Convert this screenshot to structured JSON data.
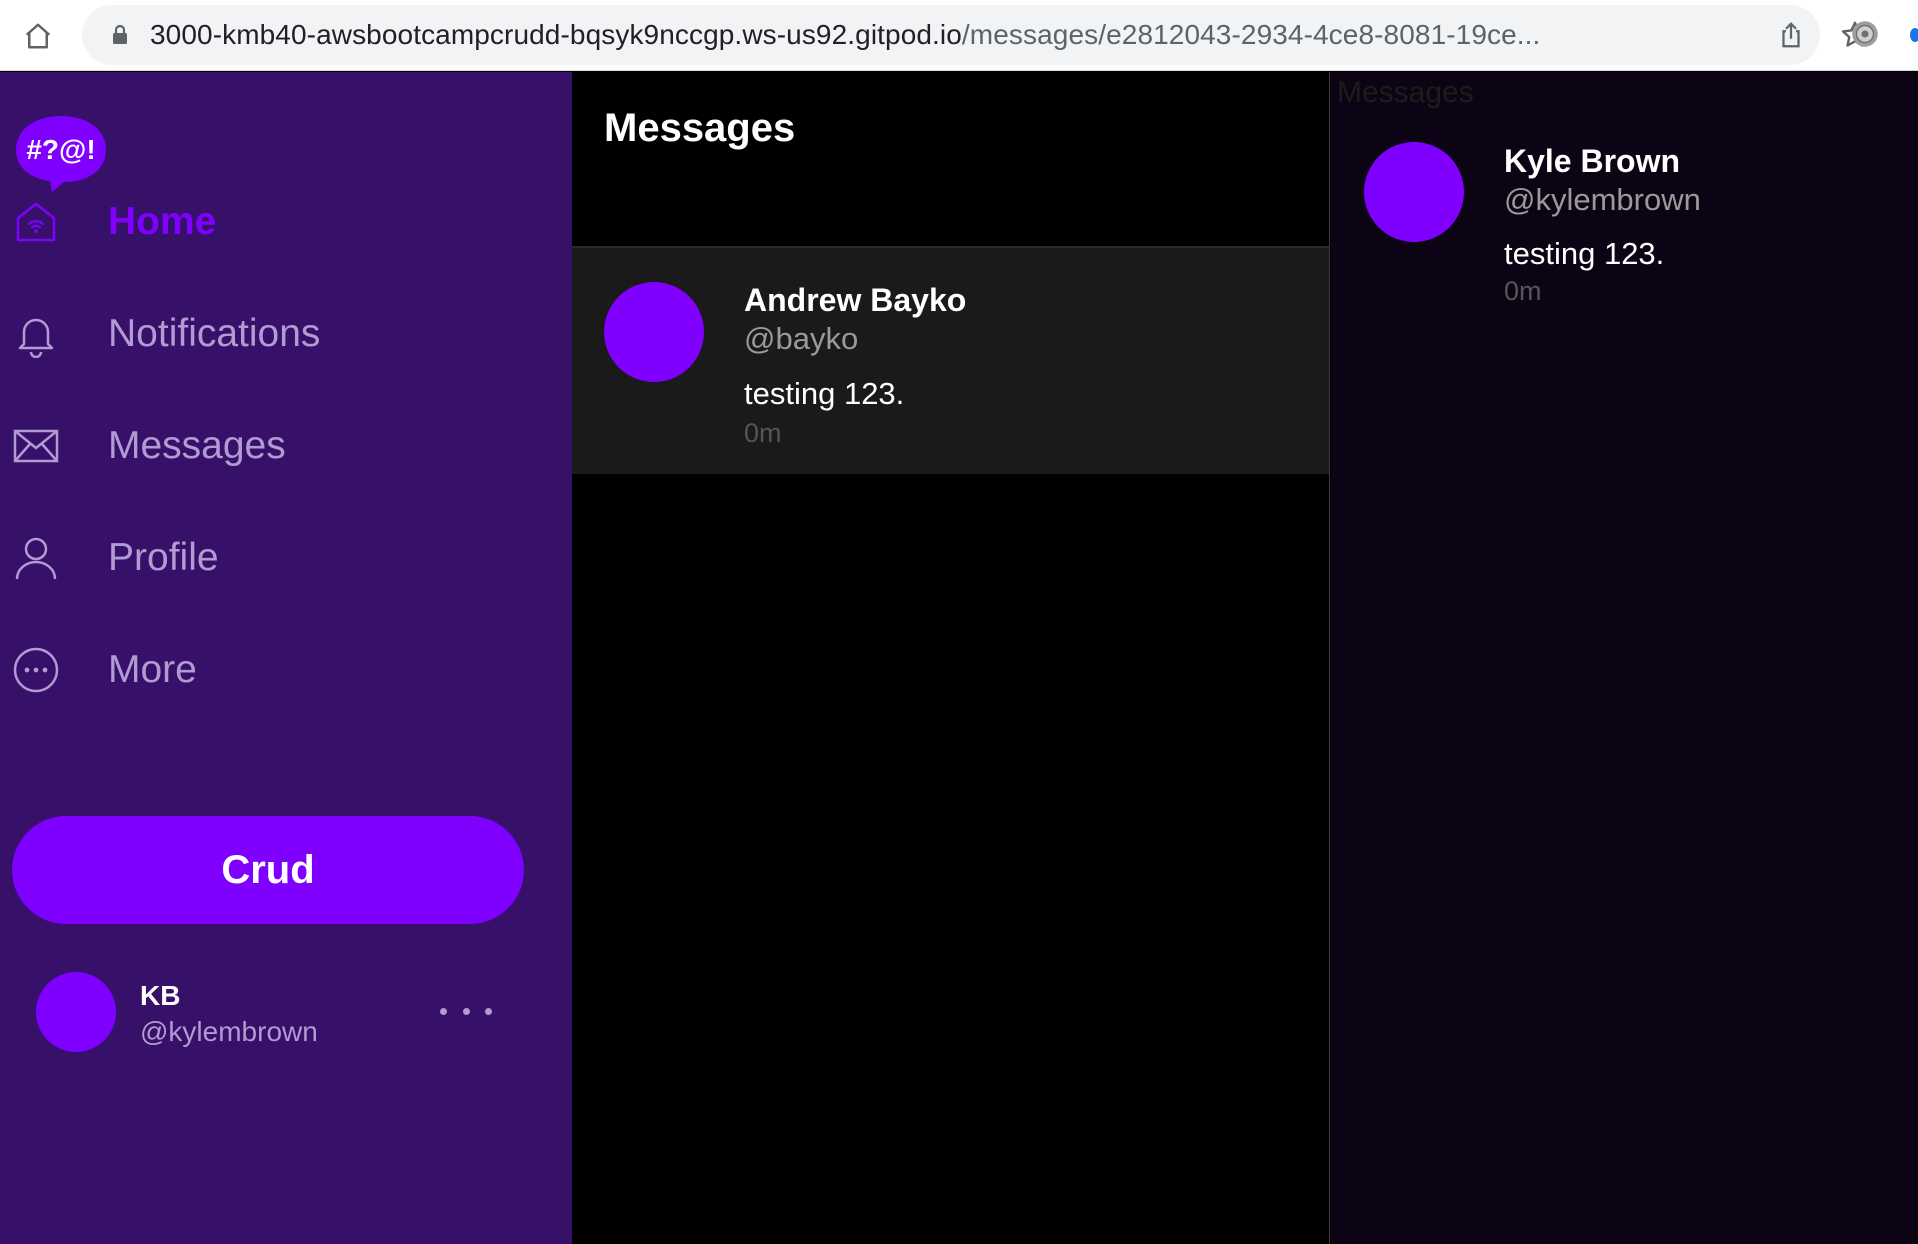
{
  "browser": {
    "url_host": "3000-kmb40-awsbootcampcrudd-bqsyk9nccgp.ws-us92.gitpod.io",
    "url_path": "/messages/e2812043-2934-4ce8-8081-19ce..."
  },
  "sidebar": {
    "logo_text": "#?@!",
    "items": [
      {
        "label": "Home",
        "icon": "home-icon",
        "active": true
      },
      {
        "label": "Notifications",
        "icon": "bell-icon",
        "active": false
      },
      {
        "label": "Messages",
        "icon": "envelope-icon",
        "active": false
      },
      {
        "label": "Profile",
        "icon": "person-icon",
        "active": false
      },
      {
        "label": "More",
        "icon": "more-circle-icon",
        "active": false
      }
    ],
    "crud_label": "Crud",
    "user": {
      "display_name": "KB",
      "handle": "@kylembrown"
    }
  },
  "groups": {
    "title": "Messages",
    "items": [
      {
        "name": "Andrew Bayko",
        "handle": "@bayko",
        "message": "testing 123.",
        "time": "0m"
      }
    ]
  },
  "conversation": {
    "heading": "Messages",
    "messages": [
      {
        "name": "Kyle Brown",
        "handle": "@kylembrown",
        "message": "testing 123.",
        "time": "0m"
      }
    ]
  },
  "colors": {
    "sidebar_bg": "#361069",
    "accent": "#8000ff",
    "nav_inactive": "#b09bd2",
    "group_item_bg": "#1a1a1a",
    "conversation_bg": "#0c0414"
  }
}
